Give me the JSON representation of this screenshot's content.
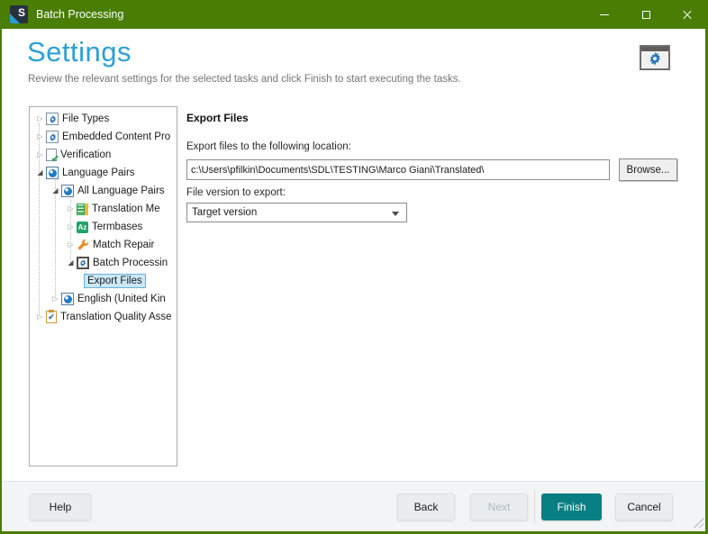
{
  "window": {
    "title": "Batch Processing",
    "controls": {
      "minimize": "minimize",
      "maximize": "maximize",
      "close": "close"
    }
  },
  "header": {
    "title": "Settings",
    "subtitle": "Review the relevant settings for the selected tasks and click Finish to start executing the tasks."
  },
  "tree": {
    "items": [
      {
        "label": "File Types",
        "level": 0,
        "state": "collapsed",
        "icon": "gear-document-icon"
      },
      {
        "label": "Embedded Content Pro",
        "level": 0,
        "state": "collapsed",
        "icon": "gear-document-icon"
      },
      {
        "label": "Verification",
        "level": 0,
        "state": "collapsed",
        "icon": "document-check-icon"
      },
      {
        "label": "Language Pairs",
        "level": 0,
        "state": "expanded",
        "icon": "globe-icon"
      },
      {
        "label": "All Language Pairs",
        "level": 1,
        "state": "expanded",
        "icon": "globe-icon"
      },
      {
        "label": "Translation Me",
        "level": 2,
        "state": "collapsed",
        "icon": "translation-memory-icon"
      },
      {
        "label": "Termbases",
        "level": 2,
        "state": "collapsed",
        "icon": "termbase-az-icon"
      },
      {
        "label": "Match Repair",
        "level": 2,
        "state": "collapsed",
        "icon": "wrench-icon"
      },
      {
        "label": "Batch Processin",
        "level": 2,
        "state": "expanded",
        "icon": "batch-gear-icon"
      },
      {
        "label": "Export Files",
        "level": 3,
        "state": "leaf",
        "selected": true
      },
      {
        "label": "English (United Kin",
        "level": 1,
        "state": "collapsed",
        "icon": "globe-icon"
      },
      {
        "label": "Translation Quality Asse",
        "level": 0,
        "state": "collapsed",
        "icon": "clipboard-check-icon"
      }
    ]
  },
  "panel": {
    "title": "Export Files",
    "location_label": "Export files to the following location:",
    "location_value": "c:\\Users\\pfilkin\\Documents\\SDL\\TESTING\\Marco Giani\\Translated\\",
    "browse_label": "Browse...",
    "version_label": "File version to export:",
    "version_value": "Target version"
  },
  "footer": {
    "help": "Help",
    "back": "Back",
    "next": "Next",
    "finish": "Finish",
    "cancel": "Cancel"
  },
  "colors": {
    "titlebar_green": "#497D04",
    "settings_blue": "#2B9FD8",
    "finish_teal": "#087F82",
    "selection_bg": "#CBE8FA",
    "selection_border": "#66AFE0",
    "termbase_green": "#21A366",
    "wrench_orange": "#E8891D",
    "gear_blue": "#2E77B5"
  }
}
